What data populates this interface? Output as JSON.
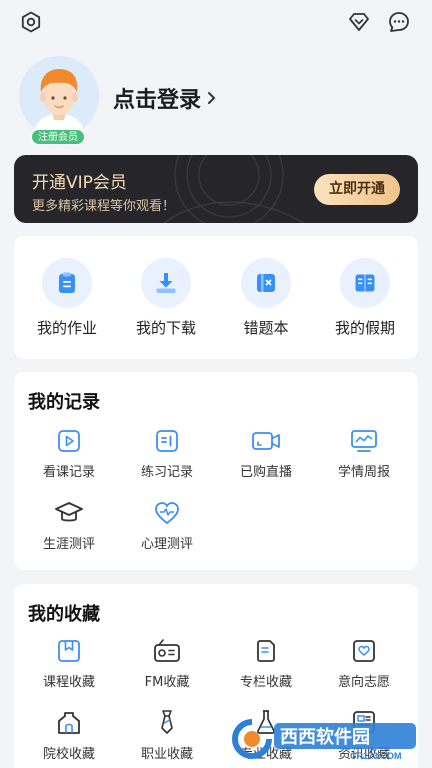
{
  "header": {
    "settings_icon": "gear-icon",
    "vip_icon": "diamond-icon",
    "message_icon": "chat-bubble-icon"
  },
  "profile": {
    "login_text": "点击登录",
    "badge": "注册会员"
  },
  "vip": {
    "title": "开通VIP会员",
    "subtitle": "更多精彩课程等你观看！",
    "button": "立即开通"
  },
  "quick_actions": [
    {
      "label": "我的作业",
      "icon": "clipboard-icon"
    },
    {
      "label": "我的下载",
      "icon": "download-icon"
    },
    {
      "label": "错题本",
      "icon": "error-book-icon"
    },
    {
      "label": "我的假期",
      "icon": "holiday-book-icon"
    }
  ],
  "records": {
    "title": "我的记录",
    "items": [
      {
        "label": "看课记录",
        "icon": "video-play-icon"
      },
      {
        "label": "练习记录",
        "icon": "practice-icon"
      },
      {
        "label": "已购直播",
        "icon": "live-camera-icon"
      },
      {
        "label": "学情周报",
        "icon": "report-chart-icon"
      },
      {
        "label": "生涯测评",
        "icon": "graduation-cap-icon"
      },
      {
        "label": "心理测评",
        "icon": "heart-pulse-icon"
      }
    ]
  },
  "favorites": {
    "title": "我的收藏",
    "items": [
      {
        "label": "课程收藏",
        "icon": "course-bookmark-icon"
      },
      {
        "label": "FM收藏",
        "icon": "radio-icon"
      },
      {
        "label": "专栏收藏",
        "icon": "column-icon"
      },
      {
        "label": "意向志愿",
        "icon": "heart-card-icon"
      },
      {
        "label": "院校收藏",
        "icon": "school-icon"
      },
      {
        "label": "职业收藏",
        "icon": "tie-icon"
      },
      {
        "label": "专业收藏",
        "icon": "flask-icon"
      },
      {
        "label": "资讯收藏",
        "icon": "news-icon"
      }
    ]
  },
  "watermark": {
    "brand": "西西软件园",
    "domain": "CR173.COM"
  },
  "colors": {
    "accent_blue": "#3a8ff7",
    "badge_green": "#46c07c",
    "vip_gold": "#f6dcb6"
  }
}
